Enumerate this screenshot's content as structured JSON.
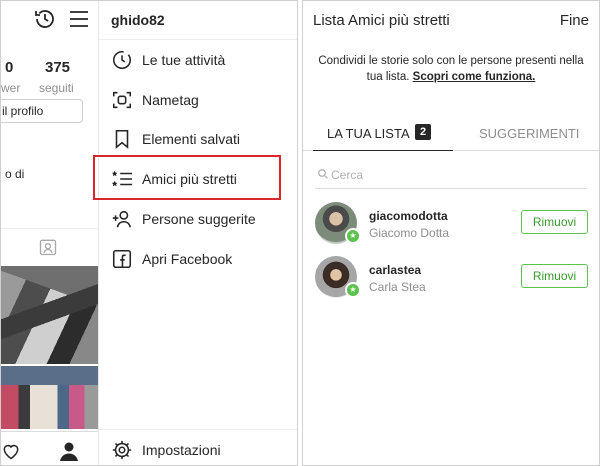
{
  "left_phone": {
    "username": "ghido82",
    "stats": {
      "followers_number": "0",
      "followers_label": "wer",
      "following_number": "375",
      "following_label": "seguiti"
    },
    "edit_profile_label": "il profilo",
    "bio_fragment": "o di",
    "menu": {
      "items": [
        {
          "label": "Le tue attività",
          "icon": "activity-clock-icon"
        },
        {
          "label": "Nametag",
          "icon": "nametag-scan-icon"
        },
        {
          "label": "Elementi salvati",
          "icon": "bookmark-icon"
        },
        {
          "label": "Amici più stretti",
          "icon": "close-friends-list-icon"
        },
        {
          "label": "Persone suggerite",
          "icon": "add-person-icon"
        },
        {
          "label": "Apri Facebook",
          "icon": "facebook-icon"
        }
      ],
      "settings_label": "Impostazioni",
      "highlighted_item": "Amici più stretti"
    },
    "icons": [
      "history-icon",
      "hamburger-menu-icon",
      "tagged-icon",
      "heart-icon",
      "profile-icon",
      "settings-gear-icon"
    ],
    "highlight_color": "#d9262d"
  },
  "right_phone": {
    "title": "Lista Amici più stretti",
    "done_label": "Fine",
    "description": "Condividi le storie solo con le persone presenti nella tua lista.",
    "learn_more": "Scopri come funziona.",
    "tabs": {
      "your_list_label": "LA TUA LISTA",
      "your_list_count": "2",
      "suggestions_label": "SUGGERIMENTI"
    },
    "search_placeholder": "Cerca",
    "friends": [
      {
        "username": "giacomodotta",
        "full_name": "Giacomo Dotta",
        "action": "Rimuovi"
      },
      {
        "username": "carlastea",
        "full_name": "Carla Stea",
        "action": "Rimuovi"
      }
    ],
    "accent_color": "#5bc24e"
  }
}
